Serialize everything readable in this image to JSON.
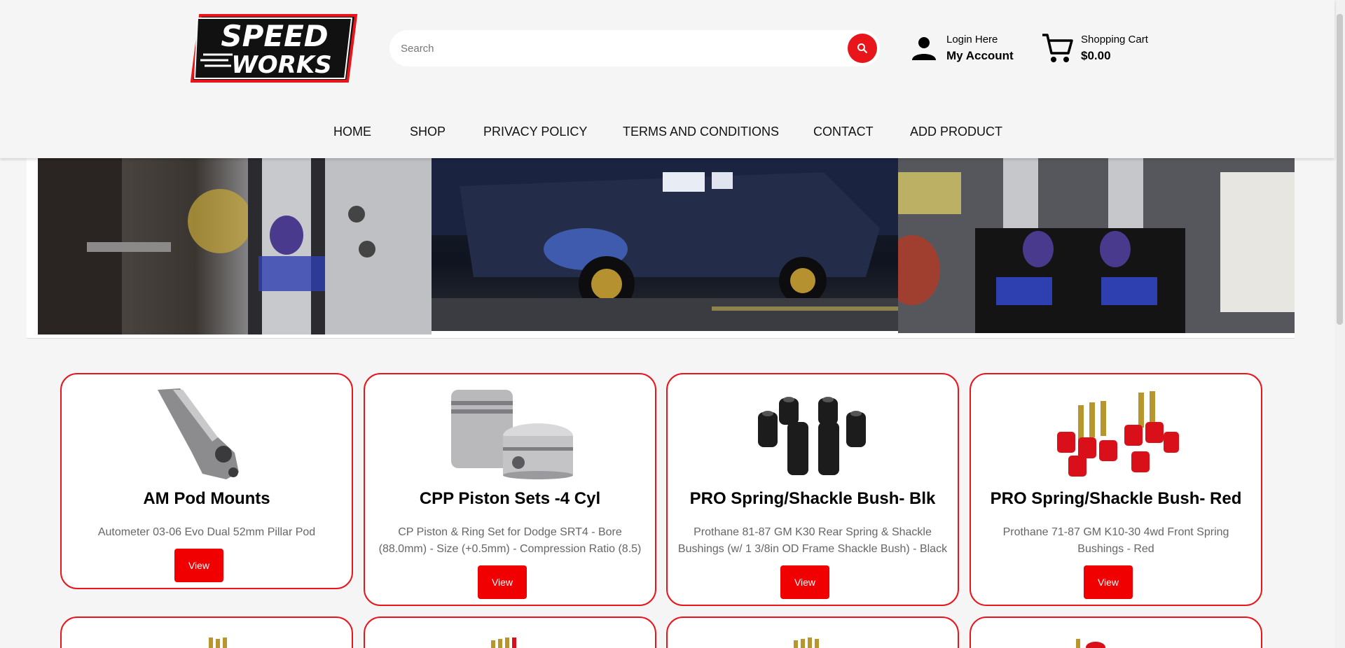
{
  "header": {
    "logo_text": [
      "SPEED",
      "WORKS"
    ],
    "search": {
      "placeholder": "Search",
      "value": ""
    },
    "account": {
      "line1": "Login Here",
      "line2": "My Account"
    },
    "cart": {
      "line1": "Shopping Cart",
      "line2": "$0.00"
    }
  },
  "nav": [
    "HOME",
    "SHOP",
    "PRIVACY POLICY",
    "TERMS AND CONDITIONS",
    "CONTACT",
    "ADD PRODUCT"
  ],
  "products": [
    {
      "title": "AM Pod Mounts",
      "description": "Autometer 03-06 Evo Dual 52mm Pillar Pod",
      "button": "View"
    },
    {
      "title": "CPP Piston Sets -4 Cyl",
      "description": "CP Piston & Ring Set for Dodge SRT4 - Bore (88.0mm) - Size (+0.5mm) - Compression Ratio (8.5)",
      "button": "View"
    },
    {
      "title": "PRO Spring/Shackle Bush- Blk",
      "description": "Prothane 81-87 GM K30 Rear Spring & Shackle Bushings (w/ 1 3/8in OD Frame Shackle Bush) - Black",
      "button": "View"
    },
    {
      "title": "PRO Spring/Shackle Bush- Red",
      "description": "Prothane 71-87 GM K10-30 4wd Front Spring Bushings - Red",
      "button": "View"
    }
  ],
  "colors": {
    "accent": "#e8151b",
    "button": "#f00000",
    "card_border": "#e8151b"
  }
}
